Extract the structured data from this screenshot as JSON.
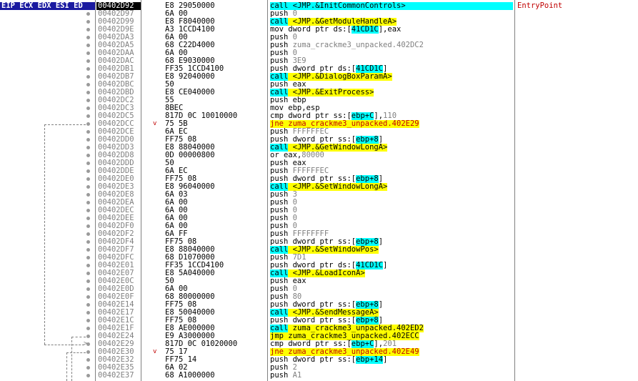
{
  "columns": {
    "registers": "EIP ECX EDX ESI ED",
    "current_address": "00402D92"
  },
  "rows": [
    {
      "addr": "00402D92",
      "bytes": "E8 29050000",
      "ins": [
        {
          "t": "call",
          "k": "call"
        },
        {
          "t": " <JMP.&InitCommonControls>",
          "k": "call"
        }
      ],
      "comment": "EntryPoint",
      "eip": true
    },
    {
      "addr": "00402D97",
      "bytes": "6A 00",
      "ins": [
        {
          "t": "push ",
          "k": "mn"
        },
        {
          "t": "0",
          "k": "op"
        }
      ]
    },
    {
      "addr": "00402D99",
      "bytes": "E8 F8040000",
      "ins": [
        {
          "t": "call",
          "k": "call"
        },
        {
          "t": " <JMP.&GetModuleHandleA>",
          "k": "jmp"
        }
      ]
    },
    {
      "addr": "00402D9E",
      "bytes": "A3 1CCD4100",
      "ins": [
        {
          "t": "mov dword ptr ds:[",
          "k": "mn"
        },
        {
          "t": "41CD1C",
          "k": "br"
        },
        {
          "t": "],eax",
          "k": "mn"
        }
      ]
    },
    {
      "addr": "00402DA3",
      "bytes": "6A 00",
      "ins": [
        {
          "t": "push ",
          "k": "mn"
        },
        {
          "t": "0",
          "k": "op"
        }
      ]
    },
    {
      "addr": "00402DA5",
      "bytes": "68 C22D4000",
      "ins": [
        {
          "t": "push ",
          "k": "mn"
        },
        {
          "t": "zuma_crackme3_unpacked.402DC2",
          "k": "op"
        }
      ]
    },
    {
      "addr": "00402DAA",
      "bytes": "6A 00",
      "ins": [
        {
          "t": "push ",
          "k": "mn"
        },
        {
          "t": "0",
          "k": "op"
        }
      ]
    },
    {
      "addr": "00402DAC",
      "bytes": "68 E9030000",
      "ins": [
        {
          "t": "push ",
          "k": "mn"
        },
        {
          "t": "3E9",
          "k": "op"
        }
      ]
    },
    {
      "addr": "00402DB1",
      "bytes": "FF35 1CCD4100",
      "ins": [
        {
          "t": "push dword ptr ds:[",
          "k": "mn"
        },
        {
          "t": "41CD1C",
          "k": "br"
        },
        {
          "t": "]",
          "k": "mn"
        }
      ]
    },
    {
      "addr": "00402DB7",
      "bytes": "E8 92040000",
      "ins": [
        {
          "t": "call",
          "k": "call"
        },
        {
          "t": " <JMP.&DialogBoxParamA>",
          "k": "jmp"
        }
      ]
    },
    {
      "addr": "00402DBC",
      "bytes": "50",
      "ins": [
        {
          "t": "push ",
          "k": "mn"
        },
        {
          "t": "eax",
          "k": "mn"
        }
      ]
    },
    {
      "addr": "00402DBD",
      "bytes": "E8 CE040000",
      "ins": [
        {
          "t": "call",
          "k": "call"
        },
        {
          "t": " <JMP.&ExitProcess>",
          "k": "jmp"
        }
      ]
    },
    {
      "addr": "00402DC2",
      "bytes": "55",
      "ins": [
        {
          "t": "push ",
          "k": "mn"
        },
        {
          "t": "ebp",
          "k": "mn"
        }
      ]
    },
    {
      "addr": "00402DC3",
      "bytes": "8BEC",
      "ins": [
        {
          "t": "mov ebp,esp",
          "k": "mn"
        }
      ]
    },
    {
      "addr": "00402DC5",
      "bytes": "817D 0C 10010000",
      "ins": [
        {
          "t": "cmp dword ptr ss:[",
          "k": "mn"
        },
        {
          "t": "ebp+C",
          "k": "br"
        },
        {
          "t": "],",
          "k": "mn"
        },
        {
          "t": "110",
          "k": "op"
        }
      ]
    },
    {
      "addr": "00402DCC",
      "bytes": "75 5B",
      "ins": [
        {
          "t": "jne zuma_crackme3_unpacked.402E29",
          "k": "jcc"
        }
      ],
      "jmark": true
    },
    {
      "addr": "00402DCE",
      "bytes": "6A EC",
      "ins": [
        {
          "t": "push ",
          "k": "mn"
        },
        {
          "t": "FFFFFFEC",
          "k": "op"
        }
      ]
    },
    {
      "addr": "00402DD0",
      "bytes": "FF75 08",
      "ins": [
        {
          "t": "push dword ptr ss:[",
          "k": "mn"
        },
        {
          "t": "ebp+8",
          "k": "br"
        },
        {
          "t": "]",
          "k": "mn"
        }
      ]
    },
    {
      "addr": "00402DD3",
      "bytes": "E8 88040000",
      "ins": [
        {
          "t": "call",
          "k": "call"
        },
        {
          "t": " <JMP.&GetWindowLongA>",
          "k": "jmp"
        }
      ]
    },
    {
      "addr": "00402DD8",
      "bytes": "0D 00000800",
      "ins": [
        {
          "t": "or eax,",
          "k": "mn"
        },
        {
          "t": "80000",
          "k": "op"
        }
      ]
    },
    {
      "addr": "00402DDD",
      "bytes": "50",
      "ins": [
        {
          "t": "push ",
          "k": "mn"
        },
        {
          "t": "eax",
          "k": "mn"
        }
      ]
    },
    {
      "addr": "00402DDE",
      "bytes": "6A EC",
      "ins": [
        {
          "t": "push ",
          "k": "mn"
        },
        {
          "t": "FFFFFFEC",
          "k": "op"
        }
      ]
    },
    {
      "addr": "00402DE0",
      "bytes": "FF75 08",
      "ins": [
        {
          "t": "push dword ptr ss:[",
          "k": "mn"
        },
        {
          "t": "ebp+8",
          "k": "br"
        },
        {
          "t": "]",
          "k": "mn"
        }
      ]
    },
    {
      "addr": "00402DE3",
      "bytes": "E8 96040000",
      "ins": [
        {
          "t": "call",
          "k": "call"
        },
        {
          "t": " <JMP.&SetWindowLongA>",
          "k": "jmp"
        }
      ]
    },
    {
      "addr": "00402DE8",
      "bytes": "6A 03",
      "ins": [
        {
          "t": "push ",
          "k": "mn"
        },
        {
          "t": "3",
          "k": "op"
        }
      ]
    },
    {
      "addr": "00402DEA",
      "bytes": "6A 00",
      "ins": [
        {
          "t": "push ",
          "k": "mn"
        },
        {
          "t": "0",
          "k": "op"
        }
      ]
    },
    {
      "addr": "00402DEC",
      "bytes": "6A 00",
      "ins": [
        {
          "t": "push ",
          "k": "mn"
        },
        {
          "t": "0",
          "k": "op"
        }
      ]
    },
    {
      "addr": "00402DEE",
      "bytes": "6A 00",
      "ins": [
        {
          "t": "push ",
          "k": "mn"
        },
        {
          "t": "0",
          "k": "op"
        }
      ]
    },
    {
      "addr": "00402DF0",
      "bytes": "6A 00",
      "ins": [
        {
          "t": "push ",
          "k": "mn"
        },
        {
          "t": "0",
          "k": "op"
        }
      ]
    },
    {
      "addr": "00402DF2",
      "bytes": "6A FF",
      "ins": [
        {
          "t": "push ",
          "k": "mn"
        },
        {
          "t": "FFFFFFFF",
          "k": "op"
        }
      ]
    },
    {
      "addr": "00402DF4",
      "bytes": "FF75 08",
      "ins": [
        {
          "t": "push dword ptr ss:[",
          "k": "mn"
        },
        {
          "t": "ebp+8",
          "k": "br"
        },
        {
          "t": "]",
          "k": "mn"
        }
      ]
    },
    {
      "addr": "00402DF7",
      "bytes": "E8 88040000",
      "ins": [
        {
          "t": "call",
          "k": "call"
        },
        {
          "t": " <JMP.&SetWindowPos>",
          "k": "jmp"
        }
      ]
    },
    {
      "addr": "00402DFC",
      "bytes": "68 D1070000",
      "ins": [
        {
          "t": "push ",
          "k": "mn"
        },
        {
          "t": "7D1",
          "k": "op"
        }
      ]
    },
    {
      "addr": "00402E01",
      "bytes": "FF35 1CCD4100",
      "ins": [
        {
          "t": "push dword ptr ds:[",
          "k": "mn"
        },
        {
          "t": "41CD1C",
          "k": "br"
        },
        {
          "t": "]",
          "k": "mn"
        }
      ]
    },
    {
      "addr": "00402E07",
      "bytes": "E8 5A040000",
      "ins": [
        {
          "t": "call",
          "k": "call"
        },
        {
          "t": " <JMP.&LoadIconA>",
          "k": "jmp"
        }
      ]
    },
    {
      "addr": "00402E0C",
      "bytes": "50",
      "ins": [
        {
          "t": "push ",
          "k": "mn"
        },
        {
          "t": "eax",
          "k": "mn"
        }
      ]
    },
    {
      "addr": "00402E0D",
      "bytes": "6A 00",
      "ins": [
        {
          "t": "push ",
          "k": "mn"
        },
        {
          "t": "0",
          "k": "op"
        }
      ]
    },
    {
      "addr": "00402E0F",
      "bytes": "68 80000000",
      "ins": [
        {
          "t": "push ",
          "k": "mn"
        },
        {
          "t": "80",
          "k": "op"
        }
      ]
    },
    {
      "addr": "00402E14",
      "bytes": "FF75 08",
      "ins": [
        {
          "t": "push dword ptr ss:[",
          "k": "mn"
        },
        {
          "t": "ebp+8",
          "k": "br"
        },
        {
          "t": "]",
          "k": "mn"
        }
      ]
    },
    {
      "addr": "00402E17",
      "bytes": "E8 50040000",
      "ins": [
        {
          "t": "call",
          "k": "call"
        },
        {
          "t": " <JMP.&SendMessageA>",
          "k": "jmp"
        }
      ]
    },
    {
      "addr": "00402E1C",
      "bytes": "FF75 08",
      "ins": [
        {
          "t": "push dword ptr ss:[",
          "k": "mn"
        },
        {
          "t": "ebp+8",
          "k": "br"
        },
        {
          "t": "]",
          "k": "mn"
        }
      ]
    },
    {
      "addr": "00402E1F",
      "bytes": "E8 AE000000",
      "ins": [
        {
          "t": "call",
          "k": "call"
        },
        {
          "t": " zuma_crackme3_unpacked.402ED2",
          "k": "jmp"
        }
      ]
    },
    {
      "addr": "00402E24",
      "bytes": "E9 A3000000",
      "ins": [
        {
          "t": "jmp zuma_crackme3_unpacked.402ECC",
          "k": "jmp"
        }
      ]
    },
    {
      "addr": "00402E29",
      "bytes": "817D 0C 01020000",
      "ins": [
        {
          "t": "cmp dword ptr ss:[",
          "k": "mn"
        },
        {
          "t": "ebp+C",
          "k": "br"
        },
        {
          "t": "],",
          "k": "mn"
        },
        {
          "t": "201",
          "k": "op"
        }
      ]
    },
    {
      "addr": "00402E30",
      "bytes": "75 17",
      "ins": [
        {
          "t": "jne zuma_crackme3_unpacked.402E49",
          "k": "jcc"
        }
      ],
      "jmark": true
    },
    {
      "addr": "00402E32",
      "bytes": "FF75 14",
      "ins": [
        {
          "t": "push dword ptr ss:[",
          "k": "mn"
        },
        {
          "t": "ebp+14",
          "k": "br"
        },
        {
          "t": "]",
          "k": "mn"
        }
      ]
    },
    {
      "addr": "00402E35",
      "bytes": "6A 02",
      "ins": [
        {
          "t": "push ",
          "k": "mn"
        },
        {
          "t": "2",
          "k": "op"
        }
      ]
    },
    {
      "addr": "00402E37",
      "bytes": "68 A1000000",
      "ins": [
        {
          "t": "push ",
          "k": "mn"
        },
        {
          "t": "A1",
          "k": "op"
        }
      ]
    }
  ],
  "colors": {
    "call_highlight": "#00ffff",
    "jump_highlight": "#ffff00",
    "comment": "#c00000",
    "address": "#808080"
  }
}
